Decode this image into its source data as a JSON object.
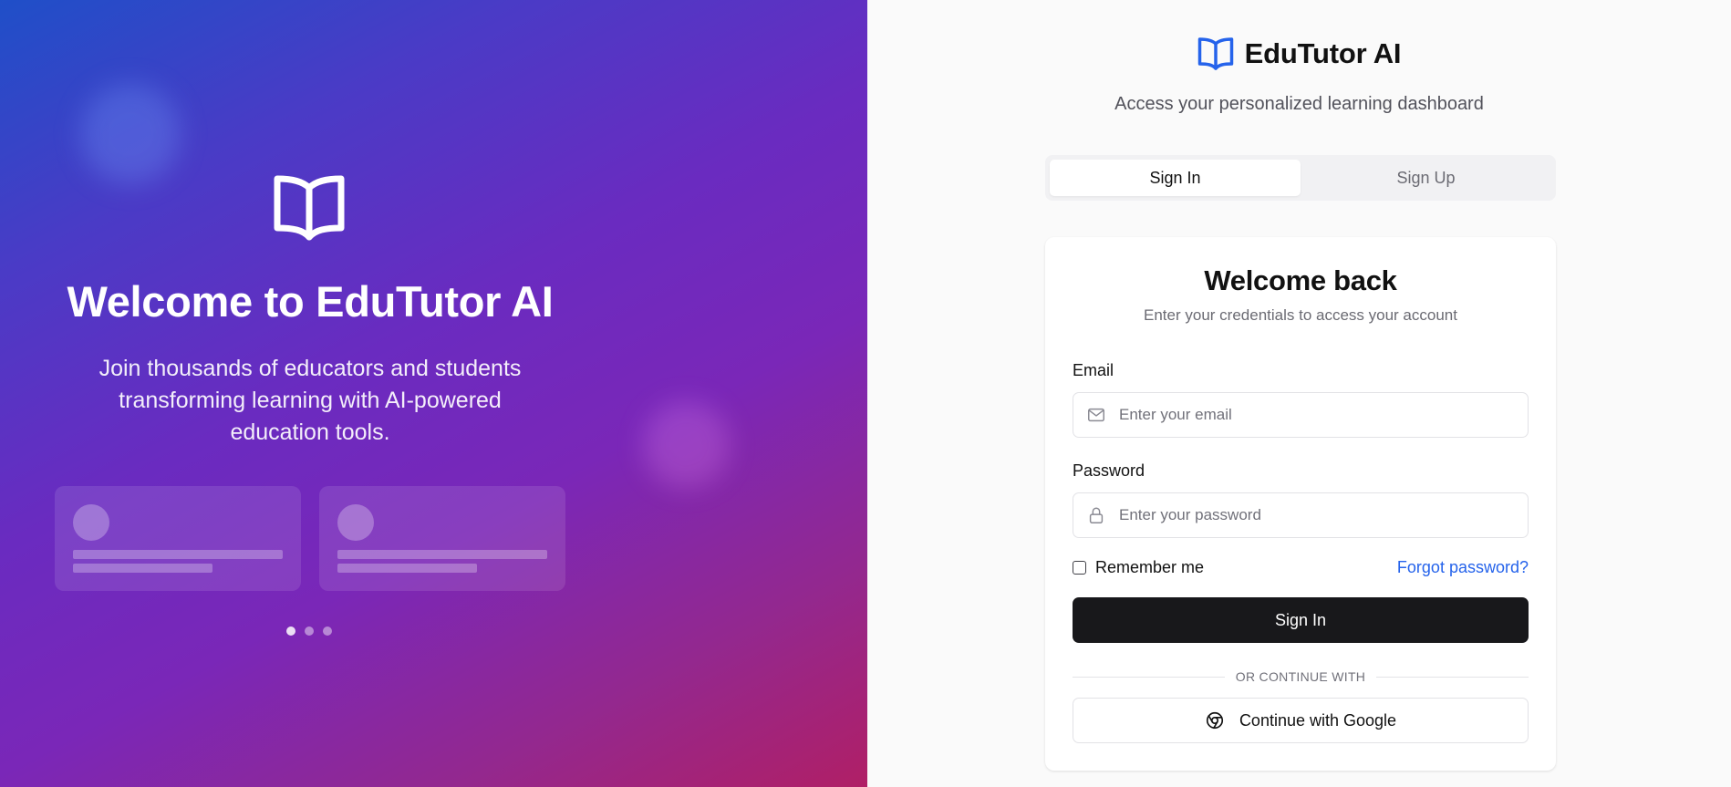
{
  "hero": {
    "icon": "book-open-icon",
    "title": "Welcome to EduTutor AI",
    "description": "Join thousands of educators and students transforming learning with AI-powered education tools.",
    "carousel_total": 3,
    "carousel_active": 1
  },
  "brand": {
    "name": "EduTutor AI",
    "icon": "book-open-icon",
    "color": "#2563eb",
    "subtitle": "Access your personalized learning dashboard"
  },
  "tabs": [
    {
      "label": "Sign In",
      "active": true
    },
    {
      "label": "Sign Up",
      "active": false
    }
  ],
  "form": {
    "title": "Welcome back",
    "subtitle": "Enter your credentials to access your account",
    "email": {
      "label": "Email",
      "placeholder": "Enter your email",
      "value": "",
      "icon": "mail-icon"
    },
    "password": {
      "label": "Password",
      "placeholder": "Enter your password",
      "value": "",
      "icon": "lock-icon"
    },
    "remember_label": "Remember me",
    "remember_checked": false,
    "forgot_label": "Forgot password?",
    "submit_label": "Sign In",
    "divider_label": "OR CONTINUE WITH",
    "google_label": "Continue with Google",
    "google_icon": "chrome-icon"
  },
  "colors": {
    "accent": "#2563eb",
    "primary_button": "#18181b",
    "gradient_start": "#1f4fc8",
    "gradient_mid": "#7a27b8",
    "gradient_end": "#b01f66"
  }
}
